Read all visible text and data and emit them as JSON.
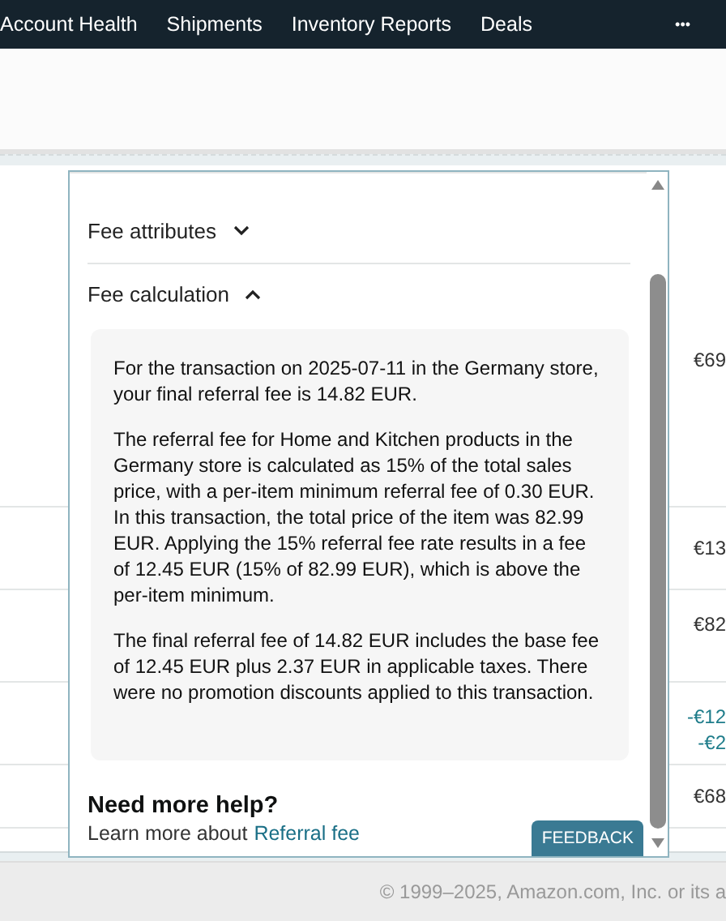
{
  "nav": {
    "items": [
      "Account Health",
      "Shipments",
      "Inventory Reports",
      "Deals"
    ],
    "more": "•••"
  },
  "table": {
    "values": [
      [
        "€69"
      ],
      [
        "€13"
      ],
      [
        "€82"
      ],
      [
        "-€12",
        "-€2"
      ],
      [
        "€68"
      ]
    ]
  },
  "popover": {
    "sections": [
      {
        "title": "Fee attributes",
        "expanded": false
      },
      {
        "title": "Fee calculation",
        "expanded": true,
        "paragraphs": [
          "For the transaction on 2025-07-11 in the Germany store, your final referral fee is 14.82 EUR.",
          "The referral fee for Home and Kitchen products in the Germany store is calculated as 15% of the total sales price, with a per-item minimum referral fee of 0.30 EUR. In this transaction, the total price of the item was 82.99 EUR. Applying the 15% referral fee rate results in a fee of 12.45 EUR (15% of 82.99 EUR), which is above the per-item minimum.",
          "The final referral fee of 14.82 EUR includes the base fee of 12.45 EUR plus 2.37 EUR in applicable taxes. There were no promotion discounts applied to this transaction."
        ]
      }
    ],
    "help_title": "Need more help?",
    "help_text": "Learn more about",
    "help_link": "Referral fee",
    "feedback": "FEEDBACK"
  },
  "footer": {
    "copyright": "© 1999–2025, Amazon.com, Inc. or its a"
  }
}
